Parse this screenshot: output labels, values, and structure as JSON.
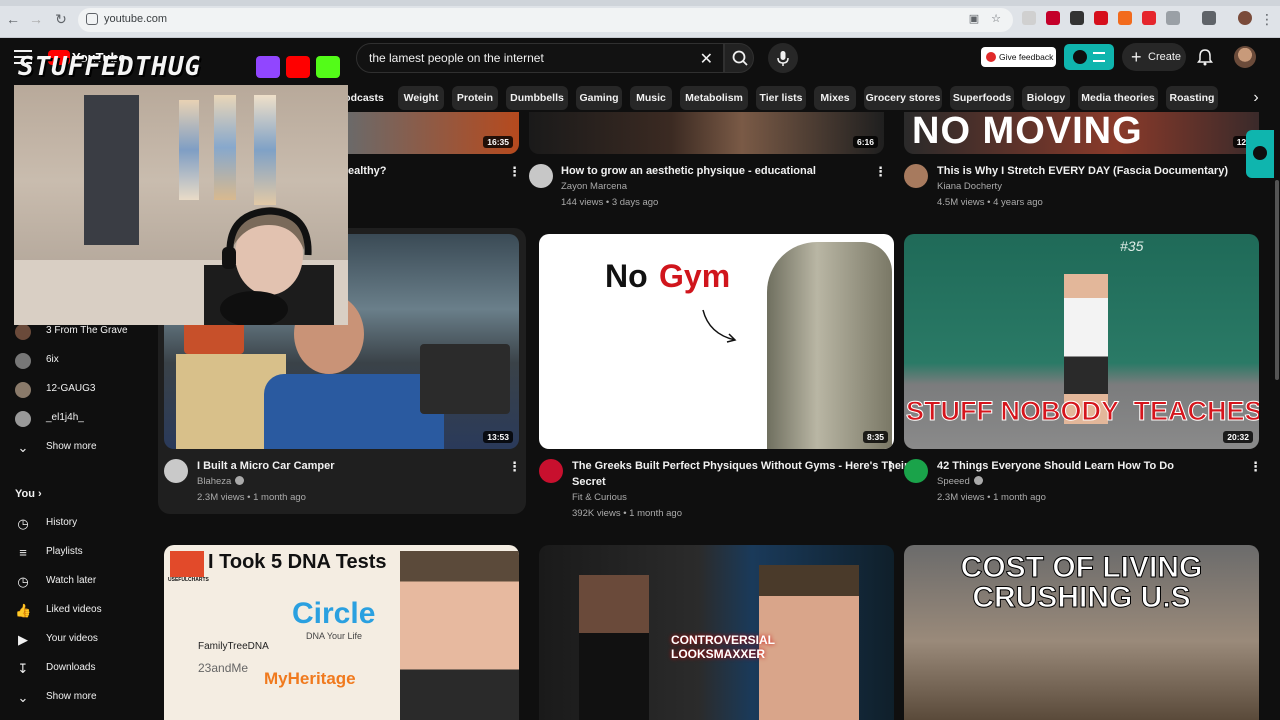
{
  "browser": {
    "url": "youtube.com"
  },
  "header": {
    "logo_text": "YouTube",
    "search_value": "the lamest people on the internet",
    "feedback_label": "Give feedback",
    "create_label": "Create"
  },
  "stream_overlay": {
    "channel_text": "STUFFEDTHUG"
  },
  "chips": [
    "odcasts",
    "Weight",
    "Protein",
    "Dumbbells",
    "Gaming",
    "Music",
    "Metabolism",
    "Tier lists",
    "Mixes",
    "Grocery stores",
    "Superfoods",
    "Biology",
    "Media theories",
    "Roasting"
  ],
  "sidebar": {
    "subscriptions": [
      {
        "label": "3 From The Grave",
        "color": "#6a4a3a"
      },
      {
        "label": "6ix",
        "color": "#777777"
      },
      {
        "label": "12-GAUG3",
        "color": "#8a7a6a"
      },
      {
        "label": "_el1j4h_",
        "color": "#999999"
      }
    ],
    "show_more_1": "Show more",
    "you_label": "You",
    "you_items": [
      {
        "label": "History",
        "icon": "history-icon"
      },
      {
        "label": "Playlists",
        "icon": "playlists-icon"
      },
      {
        "label": "Watch later",
        "icon": "watch-later-icon"
      },
      {
        "label": "Liked videos",
        "icon": "liked-videos-icon"
      },
      {
        "label": "Your videos",
        "icon": "your-videos-icon"
      },
      {
        "label": "Downloads",
        "icon": "downloads-icon"
      }
    ],
    "show_more_2": "Show more"
  },
  "videos_row0": [
    {
      "title": "ealthy?",
      "duration": "16:35"
    },
    {
      "title": "How to grow an aesthetic physique - educational",
      "channel": "Zayon Marcena",
      "meta": "144 views • 3 days ago",
      "duration": "6:16"
    },
    {
      "title": "This is Why I Stretch EVERY DAY (Fascia Documentary)",
      "channel": "Kiana Docherty",
      "meta": "4.5M views • 4 years ago",
      "duration": "12:",
      "thumb_text": "NO MOVING"
    }
  ],
  "videos_row1": [
    {
      "title": "I Built a Micro Car Camper",
      "channel": "Blaheza",
      "meta": "2.3M views • 1 month ago",
      "duration": "13:53",
      "verified": true
    },
    {
      "title_line1": "The Greeks Built Perfect Physiques Without Gyms - Here's Their",
      "title_line2": "Secret",
      "channel": "Fit & Curious",
      "meta": "392K views • 1 month ago",
      "duration": "8:35",
      "thumb_text_1": "No",
      "thumb_text_2": "Gym"
    },
    {
      "title": "42 Things Everyone Should Learn How To Do",
      "channel": "Speeed",
      "meta": "2.3M views • 1 month ago",
      "duration": "20:32",
      "verified": true,
      "thumb_text": "STUFF NOBODY  TEACHES YOU",
      "board_text": "#35"
    }
  ],
  "videos_row2": [
    {
      "thumb_text": "I Took 5 DNA Tests",
      "badge": "USEFULCHARTS",
      "brand1": "FamilyTreeDNA",
      "brand2": "Circle",
      "brand2_sub": "DNA Your Life",
      "brand3": "23andMe",
      "brand4": "MyHeritage"
    },
    {
      "thumb_text": "CONTROVERSIAL LOOKSMAXXER"
    },
    {
      "thumb_text_1": "COST OF LIVING",
      "thumb_text_2": "CRUSHING U.S"
    }
  ]
}
